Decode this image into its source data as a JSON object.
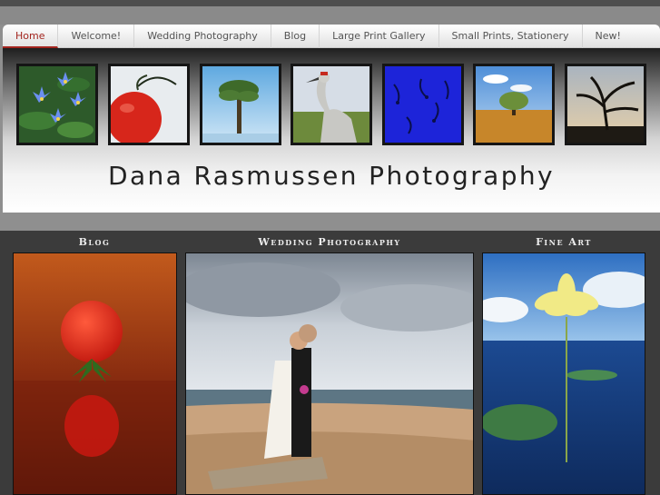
{
  "nav": {
    "items": [
      {
        "label": "Home",
        "active": true
      },
      {
        "label": "Welcome!"
      },
      {
        "label": "Wedding Photography"
      },
      {
        "label": "Blog"
      },
      {
        "label": "Large Print Gallery"
      },
      {
        "label": "Small Prints, Stationery"
      },
      {
        "label": "New!"
      }
    ]
  },
  "banner": {
    "title": "Dana Rasmussen Photography",
    "thumbnails": [
      {
        "subject": "blue water lilies"
      },
      {
        "subject": "red tomato"
      },
      {
        "subject": "tree on water"
      },
      {
        "subject": "sandhill crane"
      },
      {
        "subject": "blue reeds"
      },
      {
        "subject": "autumn tree"
      },
      {
        "subject": "silhouette tree"
      }
    ]
  },
  "sections": [
    {
      "title": "Blog"
    },
    {
      "title": "Wedding Photography"
    },
    {
      "title": "Fine Art"
    }
  ],
  "colors": {
    "accent": "#a3251f",
    "nav_text": "#555555",
    "title_text": "#222222",
    "section_bg": "#3b3b3b"
  }
}
